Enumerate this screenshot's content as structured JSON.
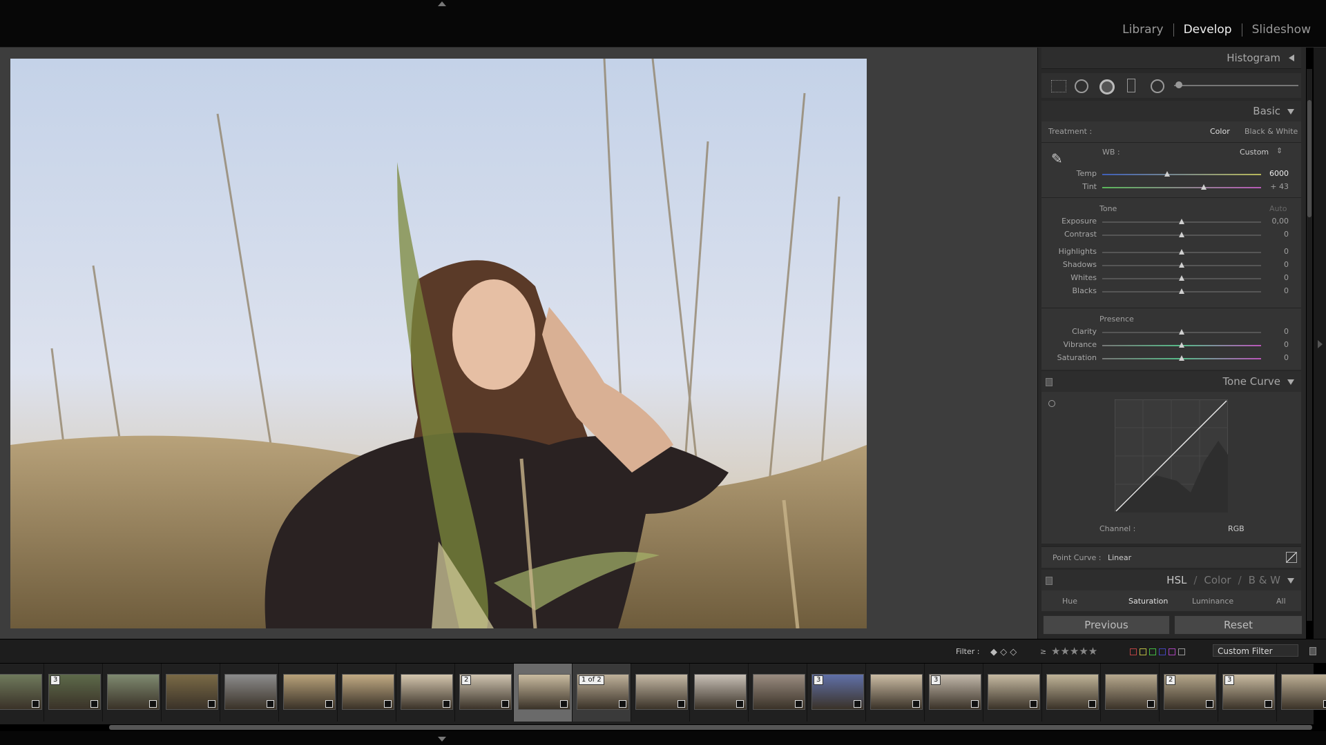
{
  "modules": [
    "Library",
    "Develop",
    "Slideshow"
  ],
  "active_module": "Develop",
  "panels": {
    "histogram": {
      "title": "Histogram"
    },
    "basic": {
      "title": "Basic",
      "treatment_label": "Treatment :",
      "treatment_color": "Color",
      "treatment_bw": "Black & White",
      "wb_label": "WB :",
      "wb_value": "Custom",
      "temp": {
        "label": "Temp",
        "value": "6000",
        "pos": 0.41
      },
      "tint": {
        "label": "Tint",
        "value": "+ 43",
        "pos": 0.64
      },
      "tone_label": "Tone",
      "auto_label": "Auto",
      "tone_sliders": [
        {
          "label": "Exposure",
          "value": "0,00",
          "pos": 0.5
        },
        {
          "label": "Contrast",
          "value": "0",
          "pos": 0.5
        },
        {
          "label": "Highlights",
          "value": "0",
          "pos": 0.5
        },
        {
          "label": "Shadows",
          "value": "0",
          "pos": 0.5
        },
        {
          "label": "Whites",
          "value": "0",
          "pos": 0.5
        },
        {
          "label": "Blacks",
          "value": "0",
          "pos": 0.5
        }
      ],
      "presence_label": "Presence",
      "presence_sliders": [
        {
          "label": "Clarity",
          "value": "0",
          "pos": 0.5
        },
        {
          "label": "Vibrance",
          "value": "0",
          "pos": 0.5
        },
        {
          "label": "Saturation",
          "value": "0",
          "pos": 0.5
        }
      ]
    },
    "tone_curve": {
      "title": "Tone Curve",
      "channel_label": "Channel :",
      "channel_value": "RGB",
      "point_curve_label": "Point Curve :",
      "point_curve_value": "Linear"
    },
    "hsl": {
      "title_hsl": "HSL",
      "title_color": "Color",
      "title_bw": "B & W",
      "sep": "/",
      "tabs": [
        "Hue",
        "Saturation",
        "Luminance",
        "All"
      ],
      "active_tab": "Saturation"
    }
  },
  "buttons": {
    "previous": "Previous",
    "reset": "Reset"
  },
  "filter": {
    "label": "Filter :",
    "preset": "Custom Filter",
    "gte": "≥"
  },
  "filmstrip": {
    "badges": [
      "",
      "3",
      "",
      "",
      "",
      "",
      "",
      "",
      "2",
      "",
      "1 of 2",
      "",
      "",
      "",
      "3",
      "",
      "3",
      "",
      "",
      "",
      "2",
      "3",
      ""
    ],
    "selected_index": 9
  },
  "colors": {
    "accent_active": "#f0f0f0",
    "panel_bg": "#343434",
    "viewer_bg": "#3d3d3d"
  }
}
